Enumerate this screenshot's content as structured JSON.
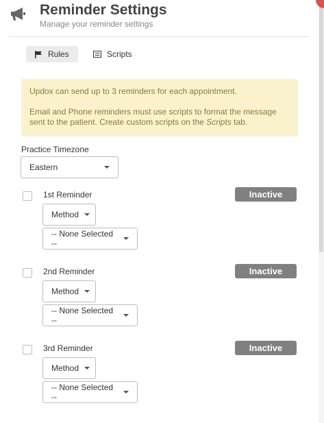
{
  "header": {
    "title": "Reminder Settings",
    "subtitle": "Manage your reminder settings",
    "icon": "megaphone-icon"
  },
  "tabs": [
    {
      "label": "Rules",
      "icon": "flag-icon",
      "active": true
    },
    {
      "label": "Scripts",
      "icon": "script-icon",
      "active": false
    }
  ],
  "alert": {
    "line1": "Updox can send up to 3 reminders for each appointment.",
    "line2_before": "Email and Phone reminders must use scripts to format the message sent to the patient. Create custom scripts on the ",
    "line2_em": "Scripts",
    "line2_after": " tab."
  },
  "timezone": {
    "label": "Practice Timezone",
    "value": "Eastern"
  },
  "reminders": [
    {
      "label": "1st Reminder",
      "status": "Inactive",
      "method": "Method",
      "selection": "-- None Selected --"
    },
    {
      "label": "2nd Reminder",
      "status": "Inactive",
      "method": "Method",
      "selection": "-- None Selected --"
    },
    {
      "label": "3rd Reminder",
      "status": "Inactive",
      "method": "Method",
      "selection": "-- None Selected --"
    }
  ],
  "colors": {
    "alert_bg": "#f9f2cc",
    "alert_text": "#8a7a3c",
    "badge_bg": "#808080",
    "active_tab_bg": "#ebebeb"
  }
}
